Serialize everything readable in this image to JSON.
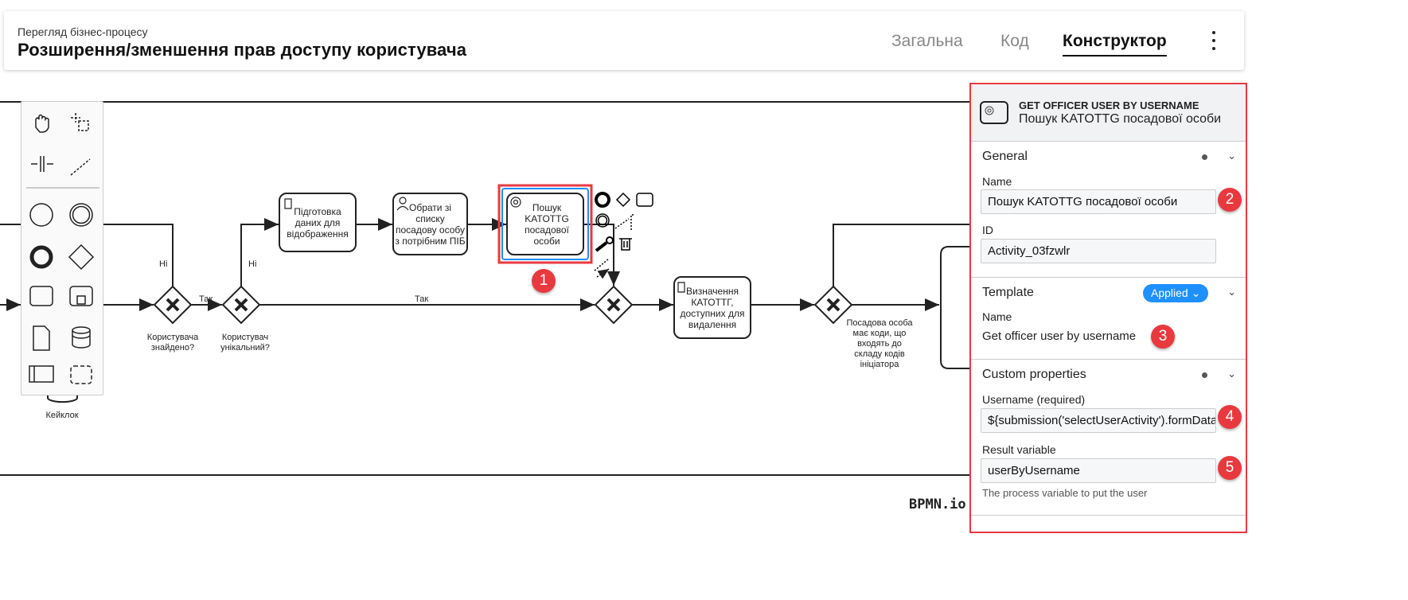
{
  "header": {
    "subtitle": "Перегляд бізнес-процесу",
    "title": "Розширення/зменшення прав доступу користувача",
    "tabs": [
      {
        "label": "Загальна",
        "active": false
      },
      {
        "label": "Код",
        "active": false
      },
      {
        "label": "Конструктор",
        "active": true
      }
    ],
    "menu_icon": "kebab-icon"
  },
  "diagram": {
    "tasks": [
      {
        "label": "Підготовка даних для відображення",
        "type": "script"
      },
      {
        "label": "Обрати зі списку посадову особу з потрібним ПІБ",
        "type": "user"
      },
      {
        "label": "Пошук KATOTTG посадової особи",
        "type": "service",
        "selected": true
      },
      {
        "label": "Визначення КАТОТТГ, доступних для видалення",
        "type": "script"
      }
    ],
    "gateways": [
      {
        "label": "Користувача знайдено?"
      },
      {
        "label": "Користувач унікальний?"
      },
      {
        "label": ""
      },
      {
        "label": "Посадова особа має коди, що входять до складу кодів ініціатора"
      }
    ],
    "flow_labels": {
      "no1": "Ні",
      "no2": "Ні",
      "yes1": "Так",
      "yes2": "Так"
    },
    "datastore_label": "Кейклок",
    "watermark": "BPMN.io"
  },
  "palette": [
    "hand-tool-icon",
    "lasso-tool-icon",
    "space-tool-icon",
    "connect-tool-icon",
    "start-event-icon",
    "intermediate-event-icon",
    "end-event-icon",
    "gateway-icon",
    "task-icon",
    "subprocess-icon",
    "data-object-icon",
    "data-store-icon",
    "pool-icon",
    "group-icon"
  ],
  "panel": {
    "element_type": "GET OFFICER USER BY USERNAME",
    "element_name": "Пошук KATOTTG  посадової особи",
    "general": {
      "title": "General",
      "name_label": "Name",
      "name_value": "Пошук KATOTTG  посадової особи",
      "id_label": "ID",
      "id_value": "Activity_03fzwlr"
    },
    "template": {
      "title": "Template",
      "badge": "Applied",
      "name_label": "Name",
      "name_value": "Get officer user by username"
    },
    "custom": {
      "title": "Custom properties",
      "username_label": "Username (required)",
      "username_value": "${submission('selectUserActivity').formData",
      "result_label": "Result variable",
      "result_value": "userByUsername",
      "result_hint": "The process variable to put the user"
    }
  },
  "annotations": [
    "1",
    "2",
    "3",
    "4",
    "5"
  ],
  "colors": {
    "highlight": "#e8393f",
    "selection": "#1e90ff",
    "applied_badge": "#1e90ff"
  }
}
